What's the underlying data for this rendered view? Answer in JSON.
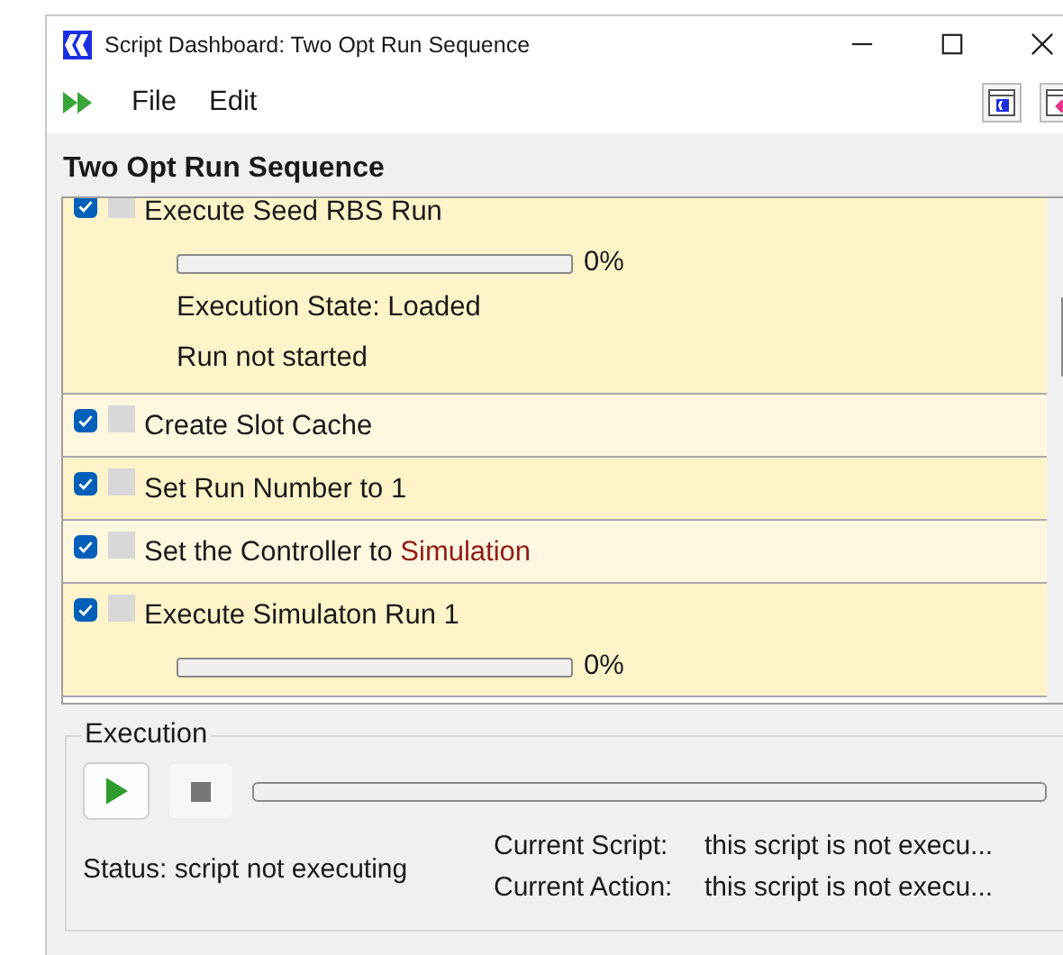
{
  "window": {
    "title": "Script Dashboard: Two Opt Run Sequence"
  },
  "menu": [
    "File",
    "Edit"
  ],
  "sequence_title": "Two Opt Run Sequence",
  "actions": [
    {
      "kind": "run",
      "checked": true,
      "text": "Execute Seed RBS Run",
      "level": 0,
      "percent": "0%",
      "state": "Execution State: Loaded",
      "run_status": "Run not started"
    },
    {
      "kind": "plain",
      "checked": true,
      "text": "Create Slot Cache"
    },
    {
      "kind": "plain",
      "checked": true,
      "text": "Set Run Number to 1"
    },
    {
      "kind": "plain",
      "checked": true,
      "text": "Set the Controller to ",
      "value": "Simulation"
    },
    {
      "kind": "run",
      "checked": true,
      "text": "Execute Simulaton Run 1",
      "level": 0,
      "percent": "0%"
    }
  ],
  "execution": {
    "legend": "Execution",
    "level": 0,
    "status": "Status: script not executing",
    "current_script_label": "Current Script:",
    "current_script": "this script is not execu...",
    "current_action_label": "Current Action:",
    "current_action": "this script is not execu..."
  }
}
